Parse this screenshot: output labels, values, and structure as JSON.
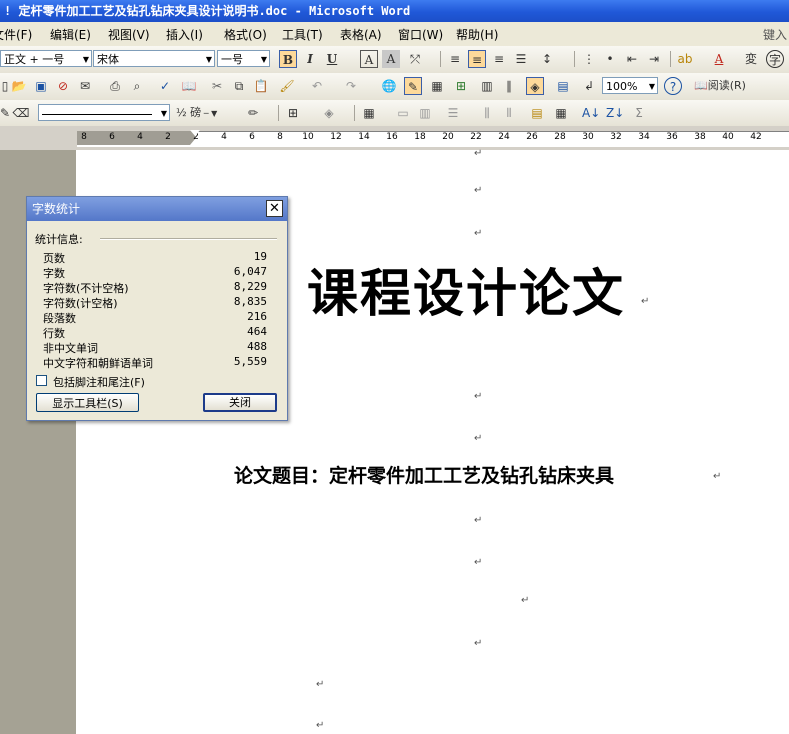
{
  "window": {
    "title": "! 定杆零件加工工艺及钻孔钻床夹具设计说明书.doc - Microsoft Word"
  },
  "menubar": {
    "items": [
      {
        "label": "文件(F)"
      },
      {
        "label": "编辑(E)"
      },
      {
        "label": "视图(V)"
      },
      {
        "label": "插入(I)"
      },
      {
        "label": "格式(O)"
      },
      {
        "label": "工具(T)"
      },
      {
        "label": "表格(A)"
      },
      {
        "label": "窗口(W)"
      },
      {
        "label": "帮助(H)"
      }
    ],
    "help_hint": "键入"
  },
  "formatting_toolbar": {
    "style": "正文 + 一号",
    "font": "宋体",
    "font_size": "一号"
  },
  "standard_toolbar": {
    "zoom": "100%",
    "read_label": "阅读(R)"
  },
  "drawing_toolbar": {
    "line_weight": "½ 磅"
  },
  "ruler": {
    "ticks": [
      "8",
      "6",
      "4",
      "2",
      "2",
      "4",
      "6",
      "8",
      "10",
      "12",
      "14",
      "16",
      "18",
      "20",
      "22",
      "24",
      "26",
      "28",
      "30",
      "32",
      "34",
      "36",
      "38",
      "40",
      "42"
    ]
  },
  "document": {
    "title": "课程设计论文",
    "subtitle": "论文题目：定杆零件加工工艺及钻孔钻床夹具",
    "paragraph_mark": "↵"
  },
  "dialog": {
    "title": "字数统计",
    "close_glyph": "✕",
    "group_label": "统计信息:",
    "stats": [
      {
        "label": "页数",
        "value": "19"
      },
      {
        "label": "字数",
        "value": "6,047"
      },
      {
        "label": "字符数(不计空格)",
        "value": "8,229"
      },
      {
        "label": "字符数(计空格)",
        "value": "8,835"
      },
      {
        "label": "段落数",
        "value": "216"
      },
      {
        "label": "行数",
        "value": "464"
      },
      {
        "label": "非中文单词",
        "value": "488"
      },
      {
        "label": "中文字符和朝鲜语单词",
        "value": "5,559"
      }
    ],
    "checkbox_label": "包括脚注和尾注(F)",
    "checkbox_checked": false,
    "show_toolbar_button": "显示工具栏(S)",
    "close_button": "关闭"
  }
}
